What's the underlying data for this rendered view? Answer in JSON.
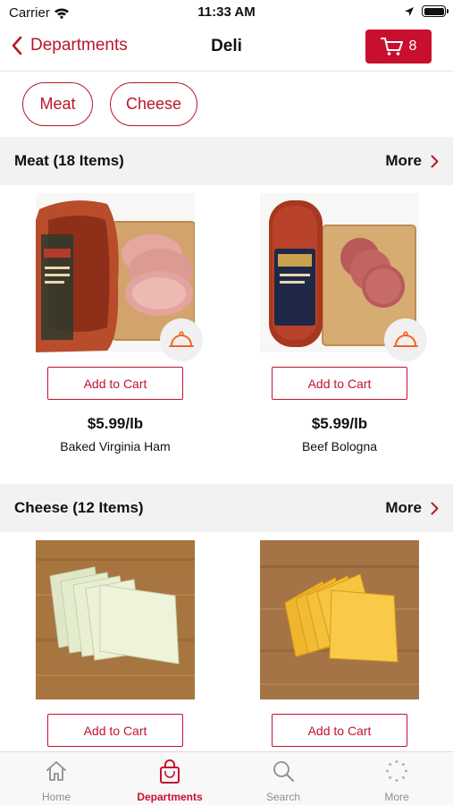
{
  "status_bar": {
    "carrier": "Carrier",
    "time": "11:33 AM"
  },
  "nav": {
    "back_label": "Departments",
    "title": "Deli",
    "cart_count": "8"
  },
  "colors": {
    "accent": "#c8102e",
    "serve_icon": "#f26522",
    "header_bg": "#f2f2f2"
  },
  "filters": [
    {
      "label": "Meat"
    },
    {
      "label": "Cheese"
    }
  ],
  "sections": [
    {
      "title": "Meat (18 Items)",
      "more_label": "More",
      "products": [
        {
          "name": "Baked Virginia Ham",
          "price": "$5.99/lb",
          "add_label": "Add to Cart",
          "icon": "serving-cloche-icon"
        },
        {
          "name": "Beef Bologna",
          "price": "$5.99/lb",
          "add_label": "Add to Cart",
          "icon": "serving-cloche-icon"
        }
      ]
    },
    {
      "title": "Cheese (12 Items)",
      "more_label": "More",
      "products": [
        {
          "add_label": "Add to Cart"
        },
        {
          "add_label": "Add to Cart"
        }
      ]
    }
  ],
  "tab_bar": [
    {
      "label": "Home",
      "icon": "home-icon"
    },
    {
      "label": "Departments",
      "icon": "shopping-bag-icon",
      "active": true
    },
    {
      "label": "Search",
      "icon": "search-icon"
    },
    {
      "label": "More",
      "icon": "more-dots-icon"
    }
  ]
}
